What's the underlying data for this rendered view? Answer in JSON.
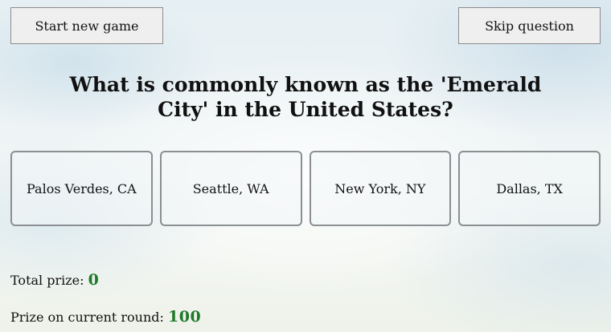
{
  "toolbar": {
    "start_label": "Start new game",
    "skip_label": "Skip question"
  },
  "question": {
    "text": "What is commonly known as the 'Emerald City' in the United States?"
  },
  "answers": [
    {
      "label": "Palos Verdes, CA"
    },
    {
      "label": "Seattle, WA"
    },
    {
      "label": "New York, NY"
    },
    {
      "label": "Dallas, TX"
    }
  ],
  "prizes": {
    "total_label": "Total prize:",
    "total_value": "0",
    "round_label": "Prize on current round:",
    "round_value": "100",
    "value_color": "#1e7a2a"
  }
}
